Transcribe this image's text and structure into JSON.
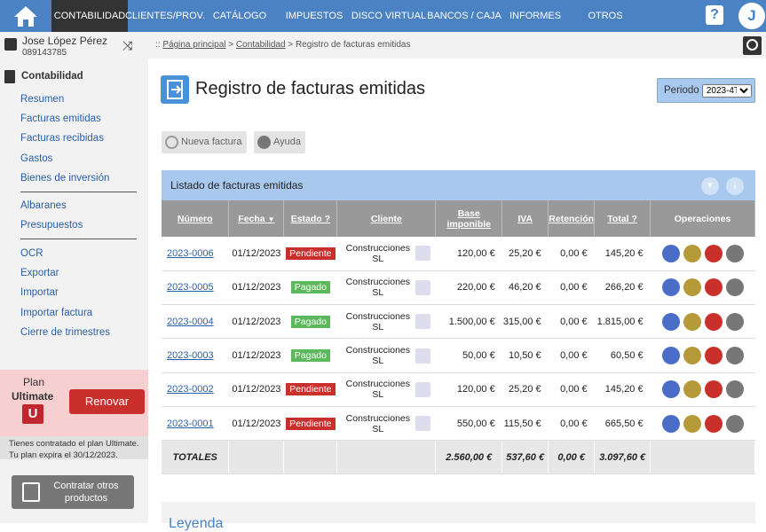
{
  "nav": {
    "items": [
      "CONTABILIDAD",
      "CLIENTES/PROV.",
      "CATÁLOGO",
      "IMPUESTOS",
      "DISCO VIRTUAL",
      "BANCOS / CAJA",
      "INFORMES",
      "OTROS"
    ],
    "help": "?",
    "avatar": "J"
  },
  "user": {
    "name": "Jose López Pérez",
    "id": "089143785"
  },
  "sidebar": {
    "section": "Contabilidad",
    "group1": [
      "Resumen",
      "Facturas emitidas",
      "Facturas recibidas",
      "Gastos",
      "Bienes de inversión"
    ],
    "group2": [
      "Albaranes",
      "Presupuestos"
    ],
    "group3": [
      "OCR",
      "Exportar",
      "Importar",
      "Importar factura",
      "Cierre de trimestres"
    ]
  },
  "plan": {
    "label": "Plan",
    "name": "Ultimate",
    "icon": "U",
    "renew": "Renovar",
    "info1": "Tienes contratado el plan Ultimate.",
    "info2": "Tu plan expira el 30/12/2023.",
    "contract": "Contratar otros productos"
  },
  "breadcrumb": {
    "prefix": "::",
    "home": "Página principal",
    "sec": "Contabilidad",
    "current": "Registro de facturas emitidas"
  },
  "page": {
    "title": "Registro de facturas emitidas",
    "periodo_label": "Periodo",
    "periodo_value": "2023-4T"
  },
  "toolbar": {
    "new": "Nueva factura",
    "help": "Ayuda"
  },
  "panel": {
    "title": "Listado de facturas emitidas"
  },
  "table": {
    "headers": [
      "Número",
      "Fecha",
      "Estado",
      "Cliente",
      "Base imponible",
      "IVA",
      "Retención",
      "Total",
      "Operaciones"
    ],
    "rows": [
      {
        "num": "2023-0006",
        "fecha": "01/12/2023",
        "estado": "Pendiente",
        "cliente": "Construcciones SL",
        "base": "120,00 €",
        "iva": "25,20 €",
        "ret": "0,00 €",
        "total": "145,20 €"
      },
      {
        "num": "2023-0005",
        "fecha": "01/12/2023",
        "estado": "Pagado",
        "cliente": "Construcciones SL",
        "base": "220,00 €",
        "iva": "46,20 €",
        "ret": "0,00 €",
        "total": "266,20 €"
      },
      {
        "num": "2023-0004",
        "fecha": "01/12/2023",
        "estado": "Pagado",
        "cliente": "Construcciones SL",
        "base": "1.500,00 €",
        "iva": "315,00 €",
        "ret": "0,00 €",
        "total": "1.815,00 €"
      },
      {
        "num": "2023-0003",
        "fecha": "01/12/2023",
        "estado": "Pagado",
        "cliente": "Construcciones SL",
        "base": "50,00 €",
        "iva": "10,50 €",
        "ret": "0,00 €",
        "total": "60,50 €"
      },
      {
        "num": "2023-0002",
        "fecha": "01/12/2023",
        "estado": "Pendiente",
        "cliente": "Construcciones SL",
        "base": "120,00 €",
        "iva": "25,20 €",
        "ret": "0,00 €",
        "total": "145,20 €"
      },
      {
        "num": "2023-0001",
        "fecha": "01/12/2023",
        "estado": "Pendiente",
        "cliente": "Construcciones SL",
        "base": "550,00 €",
        "iva": "115,50 €",
        "ret": "0,00 €",
        "total": "665,50 €"
      }
    ],
    "totals": {
      "label": "TOTALES",
      "base": "2.560,00 €",
      "iva": "537,60 €",
      "ret": "0,00 €",
      "total": "3.097,60 €"
    }
  },
  "legend": {
    "title": "Leyenda"
  },
  "colors": {
    "nav": "#4a82c4",
    "pending": "#c9302c",
    "paid": "#5cb85c"
  }
}
